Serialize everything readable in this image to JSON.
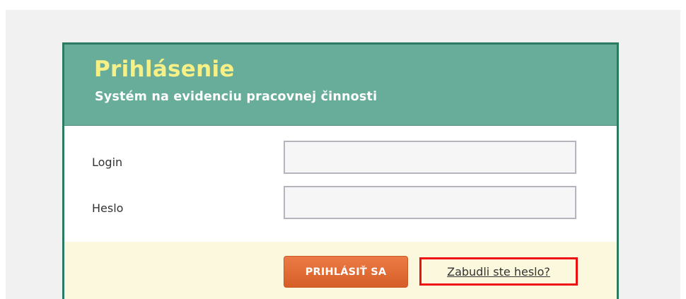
{
  "header": {
    "title": "Prihlásenie",
    "subtitle": "Systém na evidenciu pracovnej činnosti"
  },
  "form": {
    "login_label": "Login",
    "login_value": "",
    "password_label": "Heslo",
    "password_value": "",
    "submit_label": "PRIHLÁSIŤ SA",
    "forgot_password_label": "Zabudli ste heslo?"
  },
  "colors": {
    "panel_border": "#2b7a62",
    "header_background": "#68ad9a",
    "title_text": "#f6f087",
    "footer_background": "#fcf8dd",
    "submit_button": "#e06a34",
    "highlight_box": "#ee1010"
  }
}
